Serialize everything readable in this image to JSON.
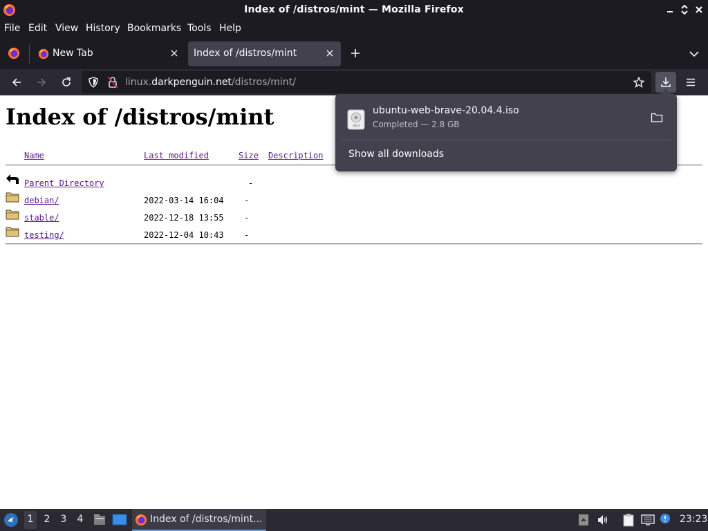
{
  "window": {
    "title": "Index of /distros/mint — Mozilla Firefox"
  },
  "menubar": {
    "items": [
      "File",
      "Edit",
      "View",
      "History",
      "Bookmarks",
      "Tools",
      "Help"
    ]
  },
  "tabs": [
    {
      "label": "New Tab",
      "active": false
    },
    {
      "label": "Index of /distros/mint",
      "active": true
    }
  ],
  "navbar": {
    "url_prefix": "linux.",
    "url_host": "darkpenguin.net",
    "url_path": "/distros/mint/"
  },
  "page": {
    "heading": "Index of /distros/mint",
    "columns": {
      "name": "Name",
      "last_modified": "Last modified",
      "size": "Size",
      "description": "Description"
    },
    "parent": {
      "name": "Parent Directory",
      "size": "-"
    },
    "rows": [
      {
        "name": "debian/",
        "modified": "2022-03-14 16:04",
        "size": "-"
      },
      {
        "name": "stable/",
        "modified": "2022-12-18 13:55",
        "size": "-"
      },
      {
        "name": "testing/",
        "modified": "2022-12-04 10:43",
        "size": "-"
      }
    ]
  },
  "downloads_panel": {
    "item": {
      "filename": "ubuntu-web-brave-20.04.4.iso",
      "status": "Completed — 2.8 GB",
      "icon_text": "ISO"
    },
    "show_all": "Show all downloads"
  },
  "taskbar": {
    "workspaces": [
      "1",
      "2",
      "3",
      "4"
    ],
    "active_task": "Index of /distros/mint...",
    "clock": "23:23"
  },
  "colors": {
    "chrome_dark": "#1c1b22",
    "toolbar": "#2b2a33",
    "active_tab": "#42414d",
    "visited_link": "#551a8b"
  }
}
